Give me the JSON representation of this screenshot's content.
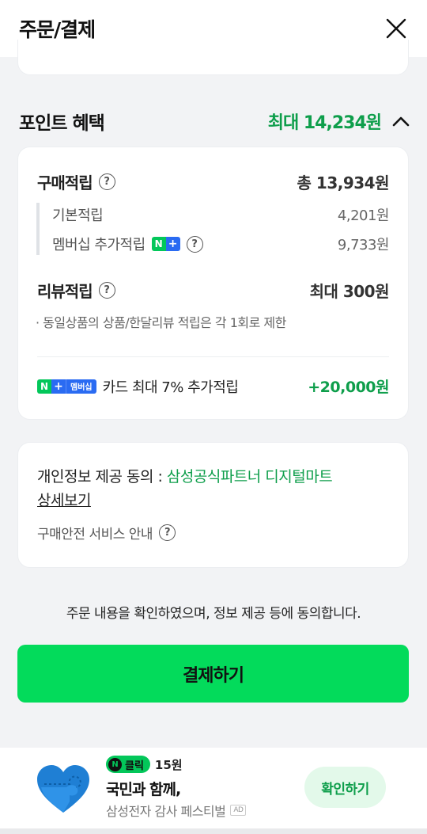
{
  "header": {
    "title": "주문/결제"
  },
  "points": {
    "section_label": "포인트 혜택",
    "max_label": "최대 14,234원",
    "purchase": {
      "label": "구매적립",
      "value": "총 13,934원"
    },
    "basic": {
      "label": "기본적립",
      "value": "4,201원"
    },
    "membership": {
      "label": "멤버십 추가적립",
      "value": "9,733원",
      "badge_n": "N",
      "badge_plus": "+"
    },
    "review": {
      "label": "리뷰적립",
      "value": "최대 300원"
    },
    "review_note": "· 동일상품의 상품/한달리뷰 적립은 각 1회로 제한",
    "card_extra": {
      "badge_n": "N",
      "badge_plus": "+",
      "badge_member": "멤버십",
      "label": "카드 최대 7% 추가적립",
      "value": "+20,000원"
    }
  },
  "privacy": {
    "prefix": "개인정보 제공 동의 : ",
    "partner": "삼성공식파트너 디지털마트",
    "detail_link": "상세보기",
    "safe_service": "구매안전 서비스 안내"
  },
  "agree_text": "주문 내용을 확인하였으며, 정보 제공 등에 동의합니다.",
  "pay_button": "결제하기",
  "ad": {
    "click_n": "N",
    "click_label": "클릭",
    "click_reward": "15원",
    "headline": "국민과 함께,",
    "subline": "삼성전자 감사 페스티벌",
    "ad_tag": "AD",
    "confirm_button": "확인하기"
  },
  "colors": {
    "accent_green": "#03db5b",
    "text_green": "#0e9e4b",
    "naver_blue": "#2a6bf2"
  }
}
